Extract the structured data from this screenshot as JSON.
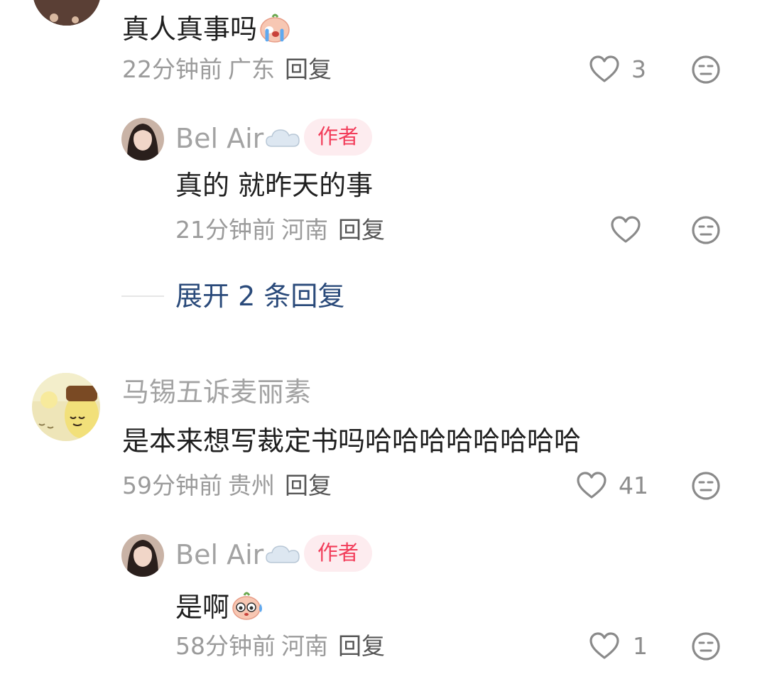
{
  "comments": [
    {
      "content": "真人真事吗",
      "content_emoji": "crying-face-emoji",
      "time": "22分钟前",
      "location": "广东",
      "reply_label": "回复",
      "likes": "3",
      "replies": [
        {
          "username": "Bel Air",
          "username_emoji": "cloud-emoji",
          "badge": "作者",
          "content": "真的 就昨天的事",
          "time": "21分钟前",
          "location": "河南",
          "reply_label": "回复",
          "likes": ""
        }
      ],
      "expand_label": "展开 2 条回复"
    },
    {
      "username": "马锡五诉麦丽素",
      "content": "是本来想写裁定书吗哈哈哈哈哈哈哈哈",
      "time": "59分钟前",
      "location": "贵州",
      "reply_label": "回复",
      "likes": "41",
      "replies": [
        {
          "username": "Bel Air",
          "username_emoji": "cloud-emoji",
          "badge": "作者",
          "content": "是啊",
          "content_emoji": "sweat-face-emoji",
          "time": "58分钟前",
          "location": "河南",
          "reply_label": "回复",
          "likes": "1"
        }
      ]
    }
  ],
  "colors": {
    "author_badge_bg": "#fdecef",
    "author_badge_text": "#f23d5a",
    "expand_link": "#2a4a7a",
    "meta_gray": "#9b9b9b",
    "icon_gray": "#8a8a8a"
  }
}
